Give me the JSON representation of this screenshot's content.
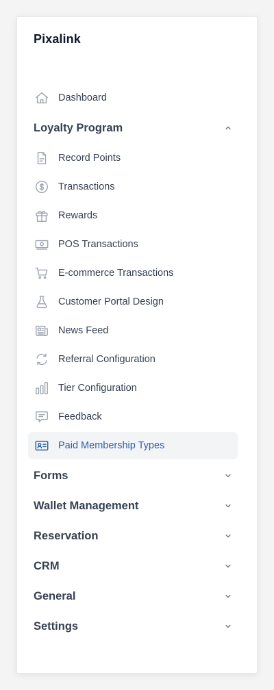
{
  "brand": {
    "title": "Pixalink"
  },
  "nav": {
    "dashboard": {
      "label": "Dashboard",
      "icon": "home-icon"
    },
    "loyalty": {
      "label": "Loyalty Program",
      "expanded": true,
      "items": [
        {
          "label": "Record Points",
          "icon": "document-icon"
        },
        {
          "label": "Transactions",
          "icon": "dollar-circle-icon"
        },
        {
          "label": "Rewards",
          "icon": "gift-icon"
        },
        {
          "label": "POS Transactions",
          "icon": "cash-icon"
        },
        {
          "label": "E-commerce Transactions",
          "icon": "shopping-cart-icon"
        },
        {
          "label": "Customer Portal Design",
          "icon": "beaker-icon"
        },
        {
          "label": "News Feed",
          "icon": "newspaper-icon"
        },
        {
          "label": "Referral Configuration",
          "icon": "refresh-icon"
        },
        {
          "label": "Tier Configuration",
          "icon": "bar-chart-icon"
        },
        {
          "label": "Feedback",
          "icon": "chat-icon"
        },
        {
          "label": "Paid Membership Types",
          "icon": "id-card-icon",
          "active": true
        }
      ]
    },
    "sections": [
      {
        "label": "Forms"
      },
      {
        "label": "Wallet Management"
      },
      {
        "label": "Reservation"
      },
      {
        "label": "CRM"
      },
      {
        "label": "General"
      },
      {
        "label": "Settings"
      }
    ]
  },
  "colors": {
    "active_text": "#2b5fa8",
    "active_bg": "#f3f4f6",
    "icon_gray": "#9ca3af",
    "text": "#374151"
  }
}
